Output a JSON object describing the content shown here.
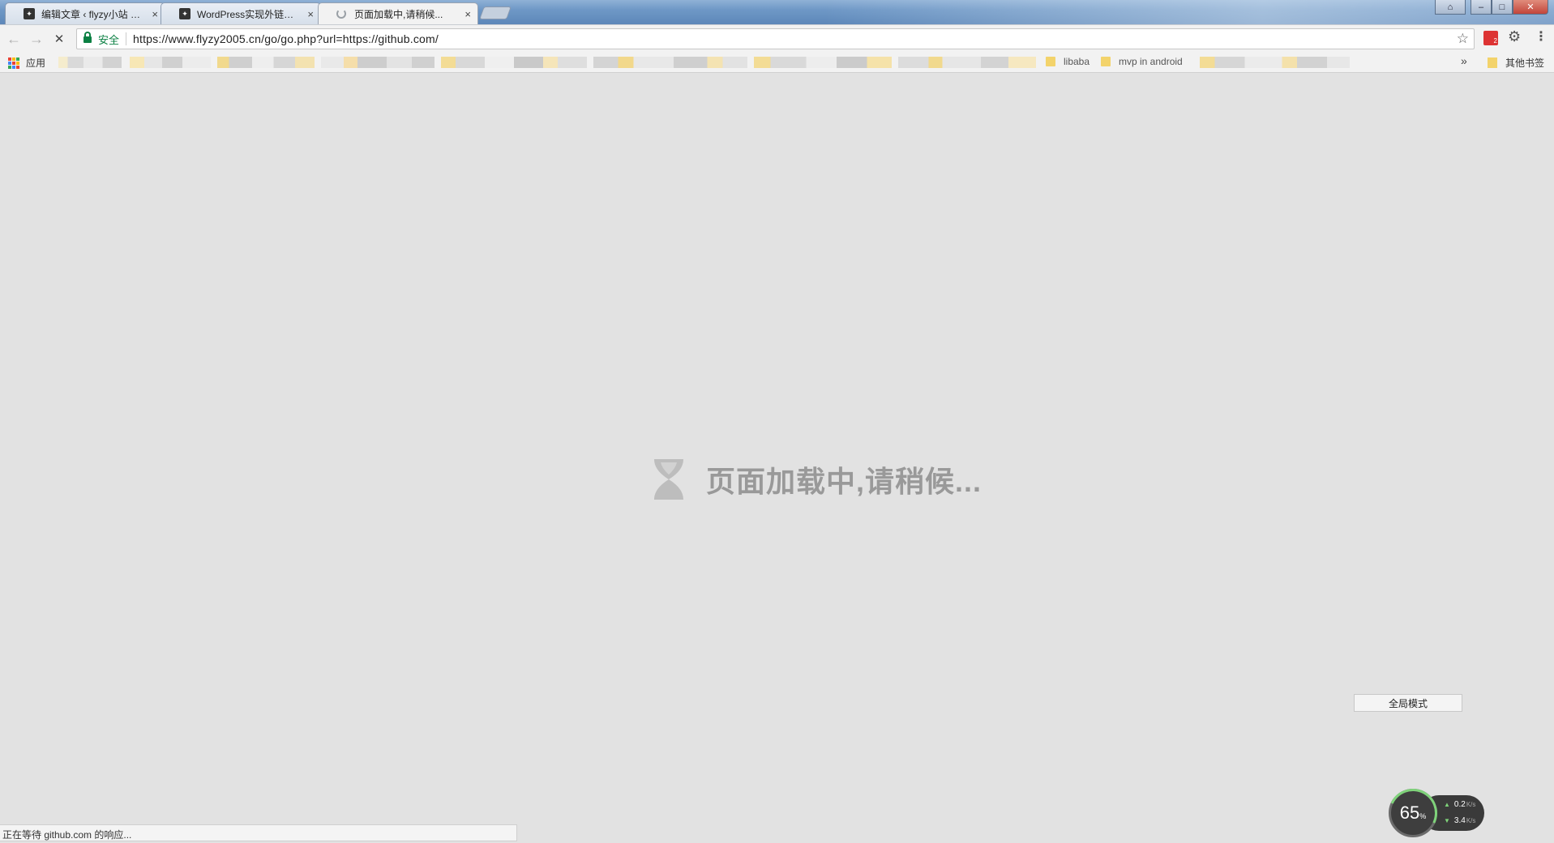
{
  "tabs": [
    {
      "title": "编辑文章 ‹ flyzy小站 — W",
      "close": "×",
      "state": "normal",
      "favicon": "site-favicon"
    },
    {
      "title": "WordPress实现外链Go跳",
      "close": "×",
      "state": "normal",
      "favicon": "site-favicon"
    },
    {
      "title": "页面加载中,请稍候...",
      "close": "×",
      "state": "loading",
      "favicon": "loading-spinner"
    }
  ],
  "toolbar": {
    "back_icon": "←",
    "forward_icon": "→",
    "reload_icon": "✕",
    "secure_label": "安全",
    "url": "https://www.flyzy2005.cn/go/go.php?url=https://github.com/",
    "star_icon": "☆",
    "extension_badge": "2",
    "gear_icon": "⚙",
    "menu_icon": "⋮"
  },
  "bookmarks": {
    "apps_label": "应用",
    "visible_items": [
      "libaba",
      "mvp in android"
    ],
    "overflow_icon": "»",
    "other_label": "其他书签"
  },
  "content": {
    "loading_message": "页面加载中,请稍候...",
    "fullscreen_button": "全局模式"
  },
  "statusbar": {
    "text": "正在等待 github.com 的响应..."
  },
  "speed_widget": {
    "percent": "65",
    "percent_unit": "%",
    "upload": "0.2",
    "download": "3.4",
    "unit": "K/s",
    "upload_arrow": "▲",
    "download_arrow": "▼"
  },
  "colors": {
    "tabstrip": "#6f98c6",
    "toolbar": "#f2f2f2",
    "content_bg": "#e2e2e2",
    "secure_green": "#0b8043",
    "loading_text": "#999999",
    "speed_accent": "#7fd37a"
  }
}
